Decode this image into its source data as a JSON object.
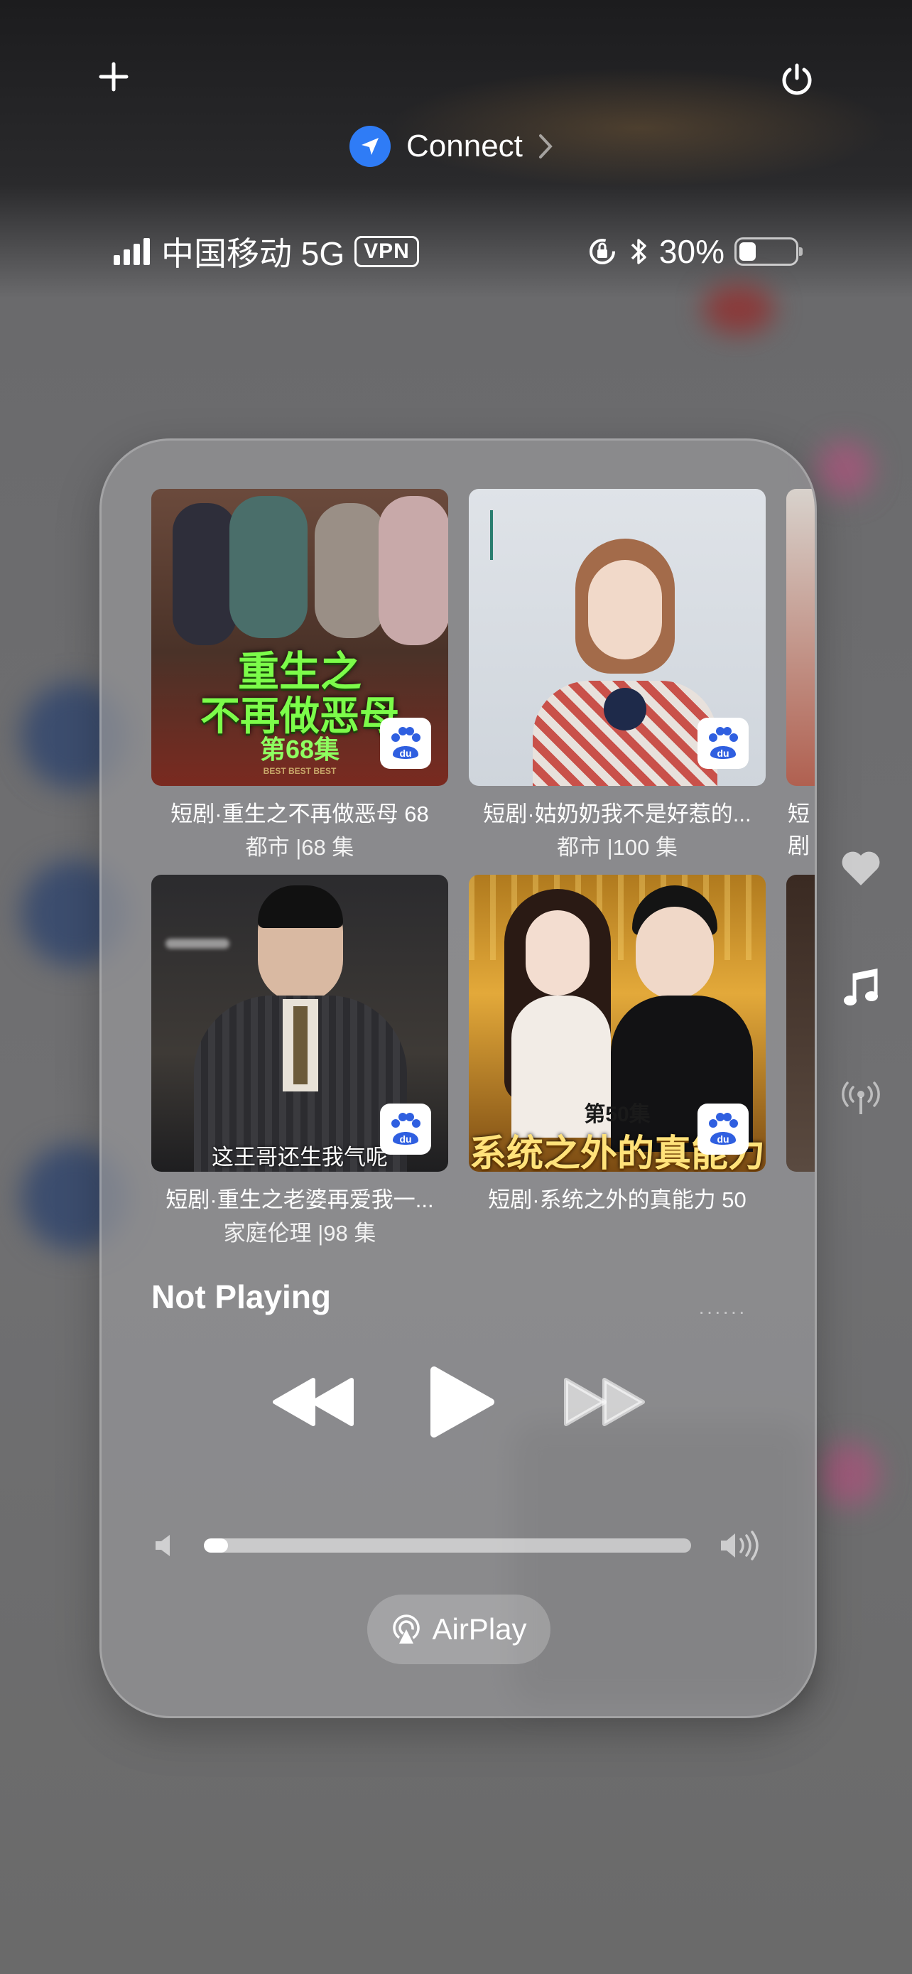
{
  "header": {
    "connect_label": "Connect"
  },
  "status_bar": {
    "carrier": "中国移动 5G",
    "vpn_label": "VPN",
    "battery_text": "30%",
    "battery_level": 0.3
  },
  "media": {
    "items": [
      {
        "name": "短剧·重生之不再做恶母 68",
        "meta": "都市 |68 集",
        "poster_title_line1": "重生之",
        "poster_title_line2": "不再做恶母",
        "poster_episode": "第68集",
        "poster_awards": "BEST   BEST   BEST"
      },
      {
        "name": "短剧·姑奶奶我不是好惹的...",
        "meta": "都市 |100 集"
      },
      {
        "name": "短剧·重生之老婆再爱我一...",
        "meta": "家庭伦理 |98 集",
        "poster_subtitle": "这王哥还生我气呢"
      },
      {
        "name": "短剧·系统之外的真能力 50",
        "meta": "",
        "poster_episode": "第50集",
        "poster_title": "系统之外的真能力"
      }
    ],
    "peek_label": "短剧",
    "badge_text": "du",
    "now_playing": "Not Playing",
    "more_dots": "······",
    "volume_level": 0.05,
    "airplay_label": "AirPlay"
  }
}
